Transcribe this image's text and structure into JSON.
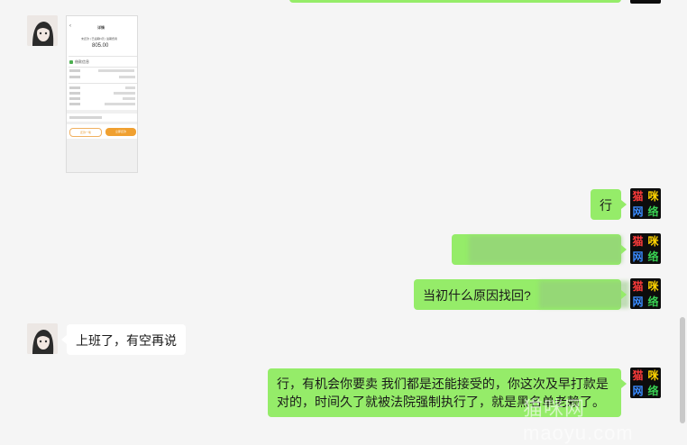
{
  "messages": {
    "ok": "行",
    "reason_question": "当初什么原因找回?",
    "busy_reply": "上班了，有空再说",
    "long_reply_line1": "行，有机会你要卖 我们都是还能接受的，你这次及早打款是",
    "long_reply_line2": "对的，时间久了就被法院强制执行了，就是黑名单老赖了。"
  },
  "avatars": {
    "left_icon": "anime-girl-avatar",
    "right_icon": "neon-text-avatar",
    "right_chars": [
      "猫",
      "咪",
      "网",
      "络"
    ]
  },
  "screenshot": {
    "page_title": "详情",
    "status": "未还款 | 已逾期N天 | 逾期费用",
    "amount": "805.00",
    "section_title": "借款信息",
    "btn_left": "还款一笔",
    "btn_right": "立即还款"
  },
  "watermark": "猫咪网 maoyu.com",
  "colors": {
    "background": "#f5f5f5",
    "bubble_self": "#95ec69",
    "bubble_other": "#ffffff"
  }
}
